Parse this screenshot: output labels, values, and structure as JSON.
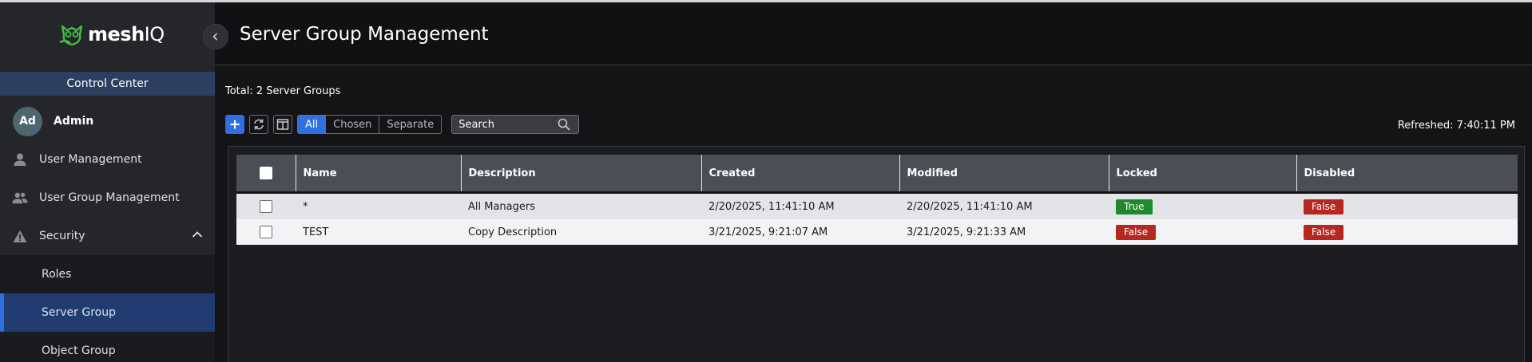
{
  "brand": {
    "logo_main": "mesh",
    "logo_accent": "IQ",
    "accent_color": "#3fbf3f"
  },
  "sidebar": {
    "section_title": "Control Center",
    "user": {
      "initials": "Ad",
      "name": "Admin"
    },
    "items": [
      {
        "label": "User Management",
        "icon": "user-icon"
      },
      {
        "label": "User Group Management",
        "icon": "users-icon"
      },
      {
        "label": "Security",
        "icon": "warning-icon",
        "expanded": true
      }
    ],
    "sub_items": [
      {
        "label": "Roles",
        "active": false
      },
      {
        "label": "Server Group",
        "active": true
      },
      {
        "label": "Object Group",
        "active": false
      }
    ]
  },
  "header": {
    "title": "Server Group Management"
  },
  "summary": {
    "total": "Total: 2 Server Groups",
    "refreshed": "Refreshed: 7:40:11 PM"
  },
  "toolbar": {
    "filters": [
      "All",
      "Chosen",
      "Separate"
    ],
    "search_placeholder": "Search"
  },
  "table": {
    "columns": [
      "Name",
      "Description",
      "Created",
      "Modified",
      "Locked",
      "Disabled"
    ],
    "rows": [
      {
        "name": "*",
        "description": "All Managers",
        "created": "2/20/2025, 11:41:10 AM",
        "modified": "2/20/2025, 11:41:10 AM",
        "locked": "True",
        "disabled": "False"
      },
      {
        "name": "TEST",
        "description": "Copy Description",
        "created": "3/21/2025, 9:21:07 AM",
        "modified": "3/21/2025, 9:21:33 AM",
        "locked": "False",
        "disabled": "False"
      }
    ]
  },
  "colors": {
    "primary": "#2f6fe0",
    "true_badge": "#1f8a2b",
    "false_badge": "#b5271f",
    "active_nav": "#203c70"
  }
}
